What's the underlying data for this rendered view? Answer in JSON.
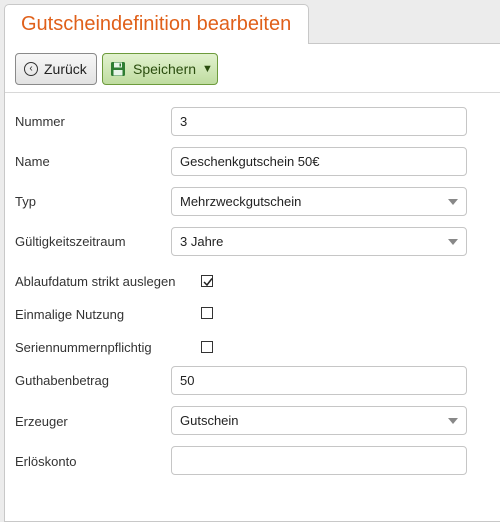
{
  "tab": {
    "title": "Gutscheindefinition bearbeiten"
  },
  "toolbar": {
    "back_label": "Zurück",
    "save_label": "Speichern",
    "save_caret": "▼"
  },
  "form": {
    "nummer": {
      "label": "Nummer",
      "value": "3"
    },
    "name": {
      "label": "Name",
      "value": "Geschenkgutschein 50€"
    },
    "typ": {
      "label": "Typ",
      "value": "Mehrzweckgutschein"
    },
    "gueltigkeit": {
      "label": "Gültigkeitszeitraum",
      "value": "3 Jahre"
    },
    "ablauf": {
      "label": "Ablaufdatum strikt auslegen",
      "checked": true
    },
    "einmalig": {
      "label": "Einmalige Nutzung",
      "checked": false
    },
    "serien": {
      "label": "Seriennummernpflichtig",
      "checked": false
    },
    "guthaben": {
      "label": "Guthabenbetrag",
      "value": "50"
    },
    "erzeuger": {
      "label": "Erzeuger",
      "value": "Gutschein"
    },
    "erloes": {
      "label": "Erlöskonto",
      "value": ""
    }
  },
  "colors": {
    "title": "#e0601a",
    "save_bg": "#d2e8bb",
    "save_border": "#6d9b3c"
  }
}
